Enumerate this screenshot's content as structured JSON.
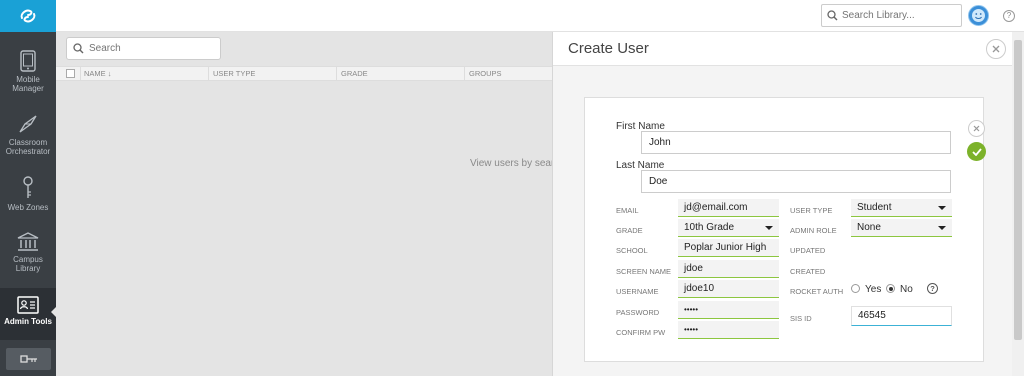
{
  "sidebar": {
    "items": [
      {
        "label": "Mobile Manager",
        "icon": "tablet-icon"
      },
      {
        "label": "Classroom Orchestrator",
        "icon": "compass-icon"
      },
      {
        "label": "Web Zones",
        "icon": "key-icon"
      },
      {
        "label": "Campus Library",
        "icon": "library-icon"
      },
      {
        "label": "Admin Tools",
        "icon": "id-card-icon",
        "active": true
      }
    ],
    "bottom_button_icon": "key-icon"
  },
  "topbar": {
    "library_search_placeholder": "Search Library...",
    "help_label": "?"
  },
  "main": {
    "search_placeholder": "Search",
    "columns": [
      "NAME ↓",
      "USER TYPE",
      "GRADE",
      "GROUPS"
    ],
    "empty_message": "View users by search"
  },
  "panel": {
    "title": "Create User",
    "first_name_label": "First Name",
    "first_name_value": "John",
    "last_name_label": "Last Name",
    "last_name_value": "Doe",
    "left_fields": [
      {
        "label": "EMAIL",
        "value": "jd@email.com"
      },
      {
        "label": "GRADE",
        "value": "10th Grade"
      },
      {
        "label": "SCHOOL",
        "value": "Poplar Junior High"
      },
      {
        "label": "SCREEN NAME",
        "value": "jdoe"
      },
      {
        "label": "USERNAME",
        "value": "jdoe10"
      },
      {
        "label": "PASSWORD",
        "value": "•••••"
      },
      {
        "label": "CONFIRM PW",
        "value": "•••••"
      }
    ],
    "right_fields": [
      {
        "label": "USER TYPE",
        "value": "Student"
      },
      {
        "label": "ADMIN ROLE",
        "value": "None"
      },
      {
        "label": "UPDATED",
        "value": ""
      },
      {
        "label": "CREATED",
        "value": ""
      },
      {
        "label": "ROCKET AUTH",
        "value": ""
      },
      {
        "label": "SIS ID",
        "value": "46545"
      }
    ],
    "rocket_auth_options": [
      "Yes",
      "No"
    ],
    "rocket_auth_selected": "No",
    "help_label": "?"
  },
  "colors": {
    "accent_green": "#7cb22a",
    "field_underline": "#8cc63f",
    "logo_blue": "#1aa1d6",
    "nav_bg": "#3a3f44"
  }
}
